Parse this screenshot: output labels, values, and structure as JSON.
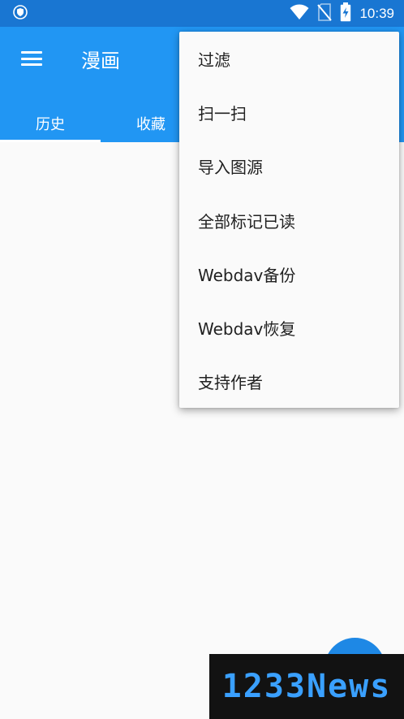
{
  "status_bar": {
    "time": "10:39",
    "icons": [
      "shield-icon",
      "wifi-icon",
      "no-sim-icon",
      "battery-charging-icon"
    ]
  },
  "app_bar": {
    "title": "漫画",
    "menu_icon": "hamburger-menu-icon",
    "background_color": "#2196f3"
  },
  "tabs": [
    {
      "label": "历史",
      "selected": true
    },
    {
      "label": "收藏",
      "selected": false
    }
  ],
  "overflow_menu": {
    "items": [
      {
        "label": "过滤"
      },
      {
        "label": "扫一扫"
      },
      {
        "label": "导入图源"
      },
      {
        "label": "全部标记已读"
      },
      {
        "label": "Webdav备份"
      },
      {
        "label": "Webdav恢复"
      },
      {
        "label": "支持作者"
      }
    ]
  },
  "watermark": {
    "text": "1233News"
  }
}
